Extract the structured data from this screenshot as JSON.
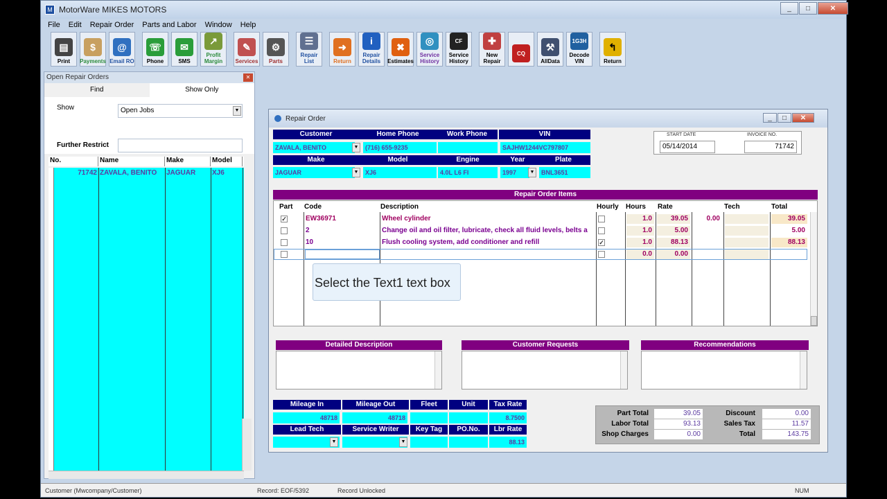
{
  "window": {
    "title": "MotorWare MIKES MOTORS"
  },
  "menu": [
    "File",
    "Edit",
    "Repair Order",
    "Parts and Labor",
    "Window",
    "Help"
  ],
  "toolbar": [
    {
      "label": "Print",
      "icon": "printer-icon",
      "color": "#444"
    },
    {
      "label": "Payments",
      "icon": "payments-icon",
      "color": "#c8a060"
    },
    {
      "label": "Email RO",
      "icon": "email-icon",
      "color": "#3070c0"
    },
    {
      "label": "Phone",
      "icon": "phone-icon",
      "color": "#2a9d3a"
    },
    {
      "label": "SMS",
      "icon": "sms-icon",
      "color": "#2a9d3a"
    },
    {
      "label": "Profit Margin",
      "icon": "profit-icon",
      "color": "#7a9a3a"
    },
    {
      "label": "Services",
      "icon": "services-icon",
      "color": "#c05050"
    },
    {
      "label": "Parts",
      "icon": "parts-icon",
      "color": "#555"
    },
    {
      "label": "Repair List",
      "icon": "repair-list-icon",
      "color": "#607090"
    },
    {
      "label": "Return",
      "icon": "return-icon",
      "color": "#e07020"
    },
    {
      "label": "Repair Details",
      "icon": "info-icon",
      "color": "#2060c0"
    },
    {
      "label": "Estimates",
      "icon": "estimates-icon",
      "color": "#e06010"
    },
    {
      "label": "Service History",
      "icon": "service-history-icon",
      "color": "#3090c0"
    },
    {
      "label": "Service History",
      "icon": "carfax-icon",
      "color": "#222"
    },
    {
      "label": "New Repair",
      "icon": "new-repair-icon",
      "color": "#c04040"
    },
    {
      "label": "",
      "icon": "carquest-icon",
      "color": "#c02020"
    },
    {
      "label": "AllData",
      "icon": "alldata-icon",
      "color": "#405070"
    },
    {
      "label": "Decode VIN",
      "icon": "decode-vin-icon",
      "color": "#2060a0"
    },
    {
      "label": "Return",
      "icon": "return-sign-icon",
      "color": "#e0b000"
    }
  ],
  "left_panel": {
    "title": "Open Repair Orders",
    "tab_find": "Find",
    "tab_show": "Show Only",
    "show_label": "Show",
    "show_value": "Open Jobs",
    "restrict_label": "Further Restrict",
    "restrict_value": "",
    "columns": [
      "No.",
      "Name",
      "Make",
      "Model"
    ],
    "rows": [
      {
        "no": "71742",
        "name": "ZAVALA, BENITO",
        "make": "JAGUAR",
        "model": "XJ6"
      }
    ]
  },
  "repair_order": {
    "title": "Repair Order",
    "customer_label": "Customer",
    "home_phone_label": "Home Phone",
    "work_phone_label": "Work Phone",
    "vin_label": "VIN",
    "customer": "ZAVALA, BENITO",
    "home_phone": "(716) 655-9235",
    "work_phone": "",
    "vin": "SAJHW1244VC797807",
    "make_label": "Make",
    "model_label": "Model",
    "engine_label": "Engine",
    "year_label": "Year",
    "plate_label": "Plate",
    "make": "JAGUAR",
    "model": "XJ6",
    "engine": "4.0L L6 FI",
    "year": "1997",
    "plate": "BNL3651",
    "start_date_label": "START DATE",
    "start_date": "05/14/2014",
    "invoice_label": "INVOICE NO.",
    "invoice_no": "71742",
    "items_title": "Repair Order Items",
    "item_cols": [
      "Part",
      "Code",
      "Description",
      "Hourly",
      "Hours",
      "Rate",
      "",
      "Tech",
      "Total"
    ],
    "items": [
      {
        "part": "✓",
        "code": "EW36971",
        "desc": "Wheel cylinder",
        "hourly": "",
        "hours": "1.0",
        "rate": "39.05",
        "extra": "0.00",
        "total": "39.05"
      },
      {
        "part": "",
        "code": "2",
        "desc": "Change oil and oil filter, lubricate, check all fluid levels, belts a",
        "hourly": "",
        "hours": "1.0",
        "rate": "5.00",
        "extra": "",
        "total": "5.00"
      },
      {
        "part": "",
        "code": "10",
        "desc": "Flush cooling system, add conditioner and refill",
        "hourly": "✓",
        "hours": "1.0",
        "rate": "88.13",
        "extra": "",
        "total": "88.13"
      },
      {
        "part": "",
        "code": "",
        "desc": "",
        "hourly": "",
        "hours": "0.0",
        "rate": "0.00",
        "extra": "",
        "total": ""
      }
    ],
    "tooltip": "Select the Text1 text box",
    "detailed_label": "Detailed Description",
    "requests_label": "Customer Requests",
    "recommend_label": "Recommendations",
    "mileage_in_label": "Mileage In",
    "mileage_out_label": "Mileage Out",
    "fleet_label": "Fleet",
    "unit_label": "Unit",
    "tax_rate_label": "Tax Rate",
    "mileage_in": "48718",
    "mileage_out": "48718",
    "tax_rate": "8.7500",
    "lead_tech_label": "Lead Tech",
    "service_writer_label": "Service Writer",
    "key_tag_label": "Key Tag",
    "po_label": "PO.No.",
    "lbr_rate_label": "Lbr Rate",
    "lbr_rate": "88.13",
    "part_total_label": "Part Total",
    "labor_total_label": "Labor Total",
    "shop_charges_label": "Shop Charges",
    "discount_label": "Discount",
    "sales_tax_label": "Sales Tax",
    "total_label": "Total",
    "part_total": "39.05",
    "labor_total": "93.13",
    "shop_charges": "0.00",
    "discount": "0.00",
    "sales_tax": "11.57",
    "total": "143.75"
  },
  "status": {
    "customer": "Customer (Mwcompany/Customer)",
    "record": "Record: EOF/5392",
    "lock": "Record Unlocked",
    "num": "NUM"
  }
}
